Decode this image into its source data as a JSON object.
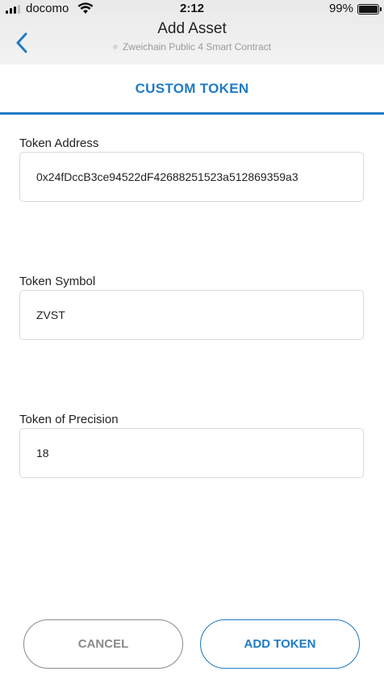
{
  "status_bar": {
    "carrier": "docomo",
    "time": "2:12",
    "battery": "99%"
  },
  "header": {
    "title": "Add Asset",
    "network": "Zweichain Public 4 Smart Contract",
    "back_icon": "chevron-left-icon"
  },
  "tab": {
    "label": "CUSTOM TOKEN"
  },
  "form": {
    "address": {
      "label": "Token Address",
      "value": "0x24fDccB3ce94522dF42688251523a512869359a3"
    },
    "symbol": {
      "label": "Token Symbol",
      "value": "ZVST"
    },
    "precision": {
      "label": "Token of Precision",
      "value": "18"
    }
  },
  "buttons": {
    "cancel": "CANCEL",
    "add": "ADD TOKEN"
  },
  "colors": {
    "accent": "#1f7bc7",
    "cancel": "#8a8a8a",
    "header_bg": "#ececec"
  }
}
